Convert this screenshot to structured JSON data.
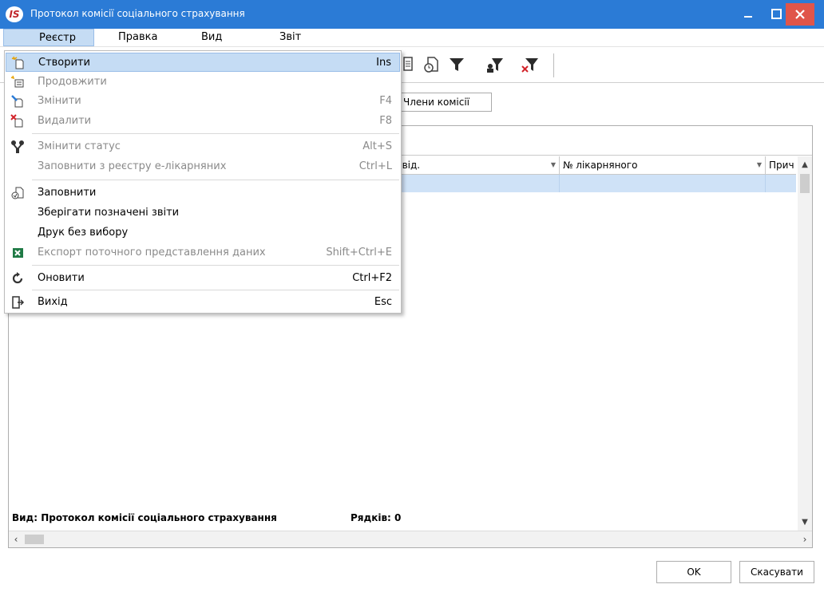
{
  "window": {
    "title": "Протокол комісії соціального страхування",
    "app_icon_text": "IS",
    "colors": {
      "titlebar": "#2b7bd6",
      "close": "#e0554a",
      "highlight": "#c5dcf4"
    }
  },
  "menubar": {
    "items": [
      {
        "label": "Реєстр"
      },
      {
        "label": "Правка"
      },
      {
        "label": "Вид"
      },
      {
        "label": "Звіт"
      }
    ]
  },
  "toolbar": {
    "icons": [
      "report-icon",
      "clock-doc-icon",
      "filter-icon",
      "user-filter-icon",
      "clear-filter-icon"
    ]
  },
  "tab_button": {
    "label": "Члени комісії"
  },
  "grid": {
    "columns": [
      {
        "label": "свід."
      },
      {
        "label": "№ лікарняного"
      },
      {
        "label": "Прич"
      }
    ],
    "status_view": "Вид: Протокол комісії соціального страхування",
    "status_rows": "Рядків: 0"
  },
  "buttons": {
    "ok": "OK",
    "cancel": "Скасувати"
  },
  "dropdown": {
    "items": [
      {
        "label": "Створити",
        "shortcut": "Ins",
        "icon": "create-icon",
        "disabled": false
      },
      {
        "label": "Продовжити",
        "shortcut": "",
        "icon": "continue-icon",
        "disabled": true
      },
      {
        "label": "Змінити",
        "shortcut": "F4",
        "icon": "edit-icon",
        "disabled": true
      },
      {
        "label": "Видалити",
        "shortcut": "F8",
        "icon": "delete-icon",
        "disabled": true
      },
      {
        "label": "Змінити статус",
        "shortcut": "Alt+S",
        "icon": "status-icon",
        "disabled": true
      },
      {
        "label": "Заповнити з реєстру е-лікарняних",
        "shortcut": "Ctrl+L",
        "icon": "",
        "disabled": true
      },
      {
        "label": "Заповнити",
        "shortcut": "",
        "icon": "fill-icon",
        "disabled": false
      },
      {
        "label": "Зберігати позначені звіти",
        "shortcut": "",
        "icon": "",
        "disabled": false
      },
      {
        "label": "Друк без вибору",
        "shortcut": "",
        "icon": "",
        "disabled": false
      },
      {
        "label": "Експорт поточного представлення даних",
        "shortcut": "Shift+Ctrl+E",
        "icon": "excel-icon",
        "disabled": true
      },
      {
        "label": "Оновити",
        "shortcut": "Ctrl+F2",
        "icon": "refresh-icon",
        "disabled": false
      },
      {
        "label": "Вихід",
        "shortcut": "Esc",
        "icon": "exit-icon",
        "disabled": false
      }
    ]
  }
}
